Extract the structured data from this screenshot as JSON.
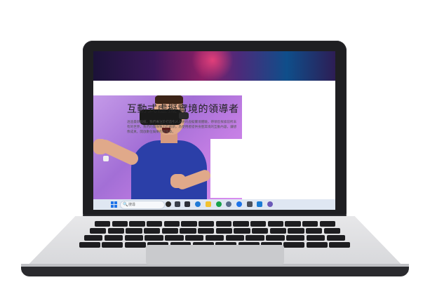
{
  "page": {
    "headline": "互動式虛擬實境的領導者",
    "body": "透過最新科技，我們專注於打造引人入勝的虛擬實境體驗，帶領您探索前所未有的世界。我們的團隊致力於創新，為使用者提供身歷其境的互動內容，讓想像成真，開啟數位娛樂的新篇章。"
  },
  "taskbar": {
    "search_placeholder": "搜尋",
    "search_glyph": "🔍",
    "apps": [
      "chat-icon",
      "file-explorer-icon",
      "edge-icon",
      "store-icon",
      "xbox-icon",
      "settings-icon",
      "terminal-icon",
      "vscode-icon",
      "browser-icon"
    ]
  },
  "colors": {
    "accent": "#1e73e8",
    "bezel": "#1f1f22",
    "photo_bg": "#b884e2",
    "shirt": "#2b3fa8",
    "taskbar": "#dfe7f2"
  }
}
